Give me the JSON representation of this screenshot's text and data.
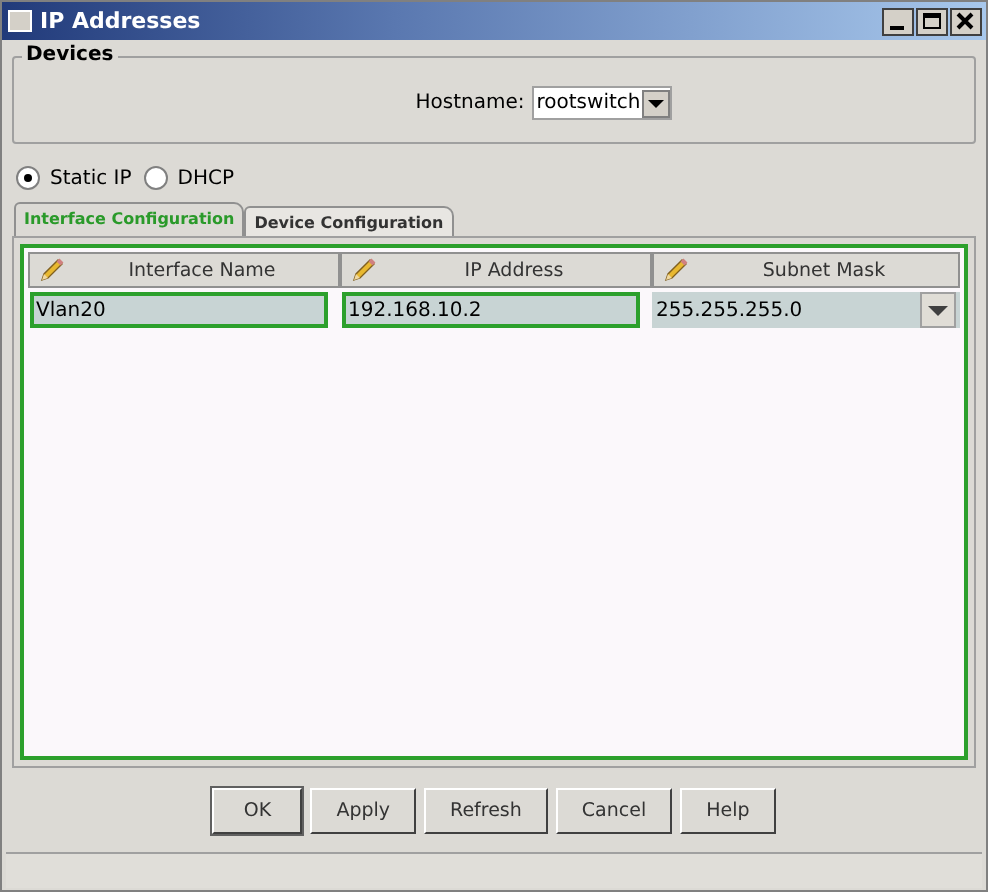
{
  "window": {
    "title": "IP Addresses"
  },
  "devices": {
    "title": "Devices",
    "hostname_label": "Hostname:",
    "hostname_value": "rootswitch"
  },
  "ip_modes": [
    {
      "label": "Static IP",
      "selected": true
    },
    {
      "label": "DHCP",
      "selected": false
    }
  ],
  "tabs": [
    {
      "label": "Interface Configuration",
      "selected": true
    },
    {
      "label": "Device Configuration",
      "selected": false
    }
  ],
  "table": {
    "columns": [
      "Interface Name",
      "IP Address",
      "Subnet Mask"
    ],
    "rows": [
      [
        {
          "kind": "text",
          "value": "Vlan20"
        },
        {
          "kind": "text",
          "value": "192.168.10.2"
        },
        {
          "kind": "combo",
          "value": "255.255.255.0"
        }
      ]
    ]
  },
  "buttons": [
    "OK",
    "Apply",
    "Refresh",
    "Cancel",
    "Help"
  ]
}
